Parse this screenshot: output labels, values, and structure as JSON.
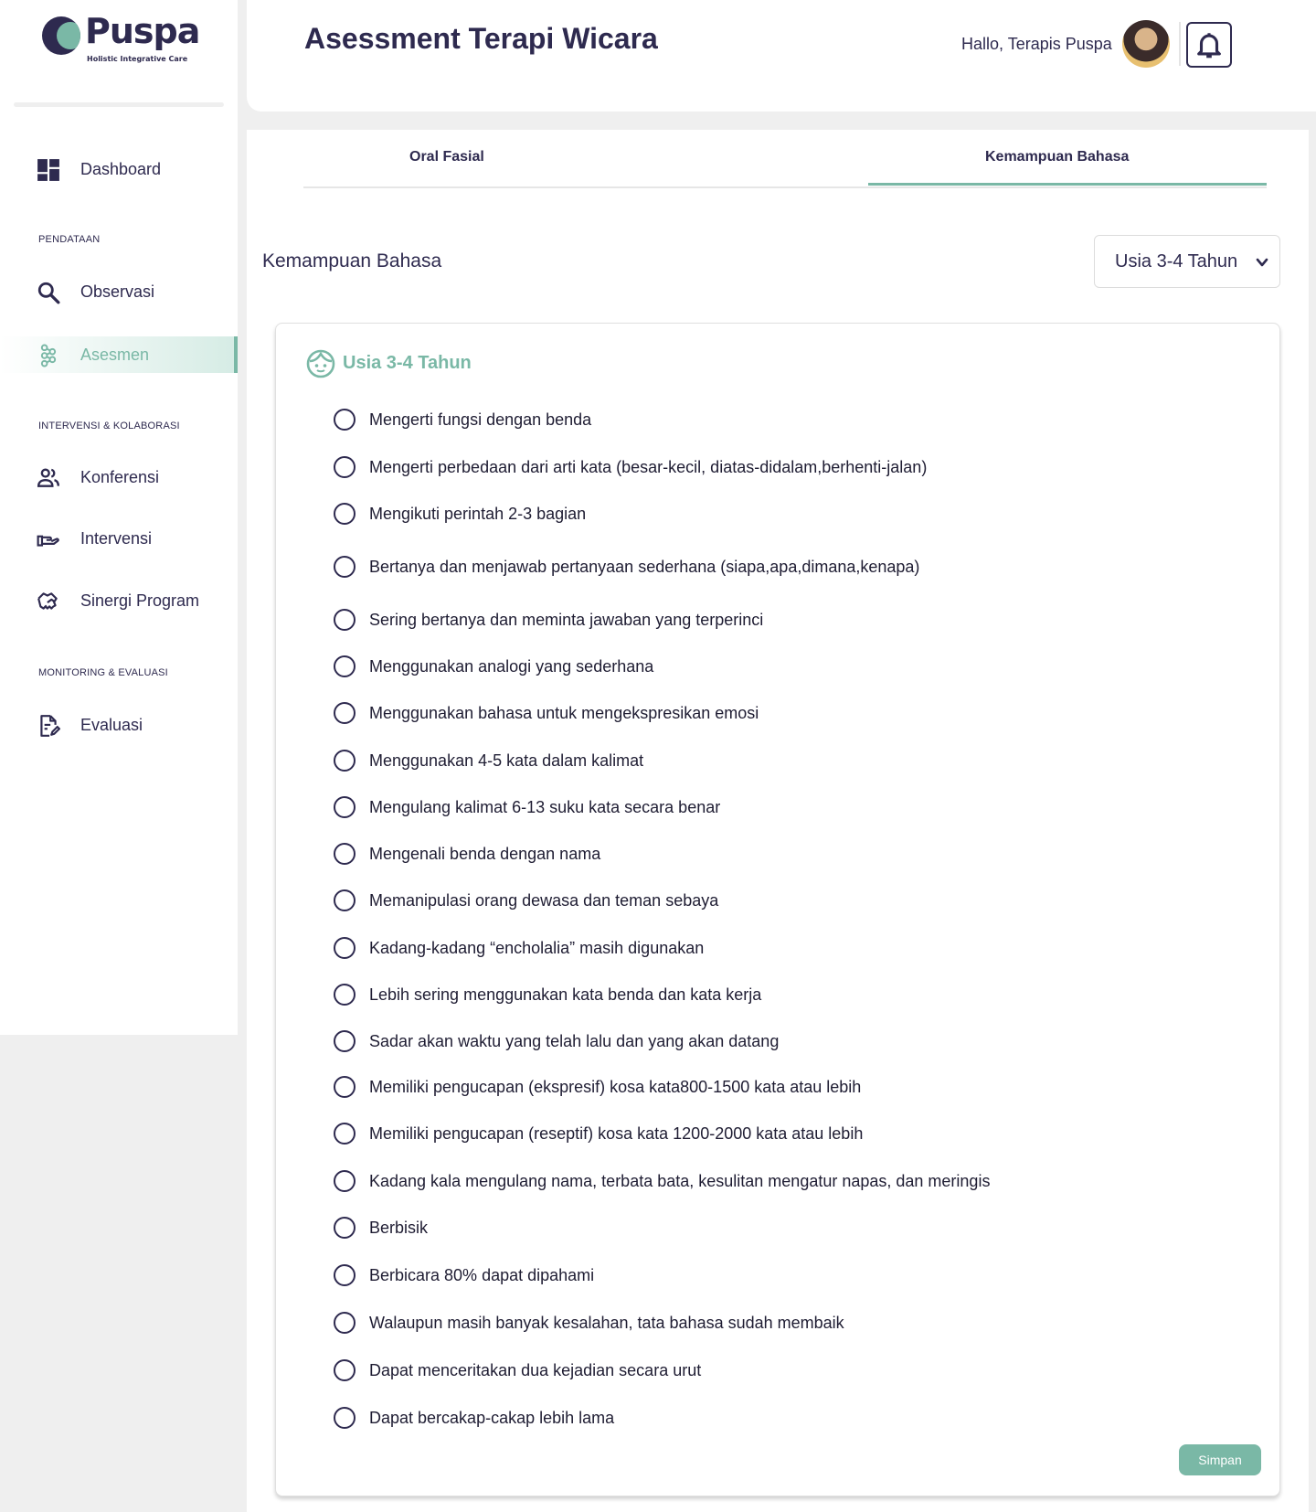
{
  "brand": {
    "name": "Puspa",
    "tagline": "Holistic Integrative Care"
  },
  "sidebar": {
    "dashboard": "Dashboard",
    "sections": {
      "pendataan": "PENDATAAN",
      "intervensi": "INTERVENSI & KOLABORASI",
      "monitoring": "MONITORING & EVALUASI"
    },
    "items": {
      "observasi": "Observasi",
      "asesmen": "Asesmen",
      "konferensi": "Konferensi",
      "intervensi": "Intervensi",
      "sinergi": "Sinergi Program",
      "evaluasi": "Evaluasi"
    },
    "active_item": "Asesmen"
  },
  "header": {
    "title": "Asessment Terapi Wicara",
    "greeting": "Hallo, Terapis Puspa"
  },
  "tabs": [
    {
      "label": "Oral Fasial",
      "active": false
    },
    {
      "label": "Kemampuan Bahasa",
      "active": true
    }
  ],
  "section": {
    "title": "Kemampuan Bahasa",
    "age_select": {
      "value": "Usia 3-4 Tahun"
    }
  },
  "card": {
    "title": "Usia 3-4 Tahun",
    "items": [
      "Mengerti fungsi dengan benda",
      "Mengerti perbedaan dari arti kata  (besar-kecil, diatas-didalam,berhenti-jalan)",
      "Mengikuti perintah 2-3 bagian",
      "Bertanya dan menjawab pertanyaan sederhana (siapa,apa,dimana,kenapa)",
      "Sering bertanya dan meminta jawaban yang terperinci",
      "Menggunakan analogi yang sederhana",
      "Menggunakan bahasa untuk mengekspresikan emosi",
      "Menggunakan 4-5 kata dalam kalimat",
      "Mengulang kalimat 6-13 suku kata secara benar",
      "Mengenali benda dengan nama",
      "Memanipulasi orang dewasa dan teman sebaya",
      "Kadang-kadang “encholalia” masih digunakan",
      "Lebih sering menggunakan kata benda dan kata kerja",
      "Sadar akan waktu yang telah lalu dan yang akan datang",
      "Memiliki pengucapan (ekspresif) kosa kata800-1500 kata atau lebih",
      "Memiliki pengucapan (reseptif) kosa kata 1200-2000 kata atau lebih",
      "Kadang kala mengulang nama, terbata bata, kesulitan mengatur napas, dan meringis",
      "Berbisik",
      "Berbicara 80% dapat dipahami",
      "Walaupun masih banyak kesalahan, tata bahasa sudah membaik",
      "Dapat menceritakan dua kejadian secara urut",
      "Dapat bercakap-cakap lebih lama"
    ],
    "save_label": "Simpan"
  },
  "colors": {
    "primary": "#2e2a4f",
    "accent": "#7ab8a6",
    "background": "#efefef"
  },
  "icons": [
    "dashboard-icon",
    "search-icon",
    "molecule-icon",
    "people-icon",
    "hand-icon",
    "handshake-icon",
    "document-edit-icon",
    "bell-icon",
    "chevron-down-icon",
    "child-face-icon",
    "radio-icon"
  ]
}
